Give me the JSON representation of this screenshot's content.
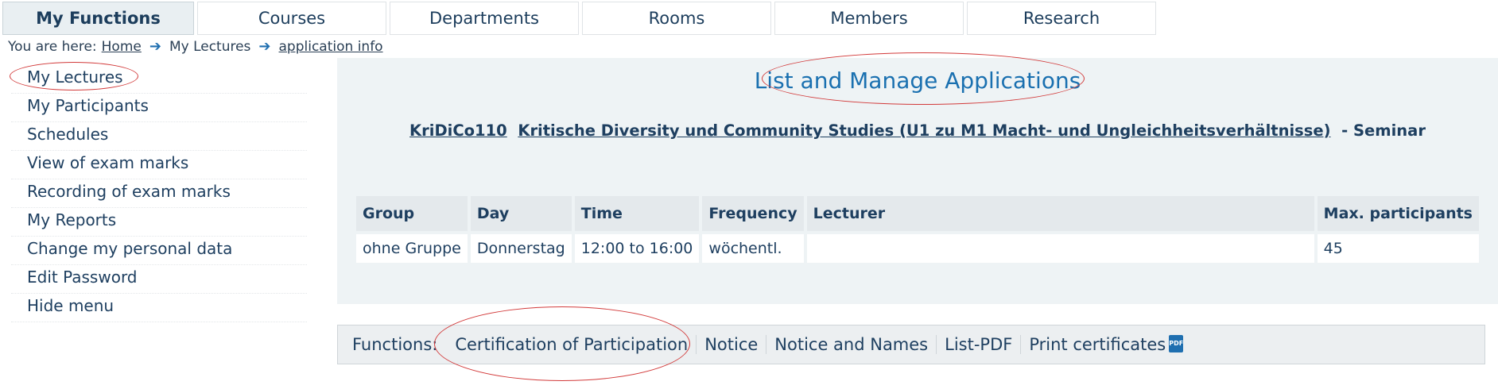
{
  "tabs": [
    {
      "label": "My Functions",
      "active": true
    },
    {
      "label": "Courses"
    },
    {
      "label": "Departments"
    },
    {
      "label": "Rooms"
    },
    {
      "label": "Members"
    },
    {
      "label": "Research"
    }
  ],
  "breadcrumb": {
    "prefix": "You are here:",
    "items": [
      "Home",
      "My Lectures",
      "application info"
    ]
  },
  "sidebar": {
    "items": [
      {
        "label": "My Lectures"
      },
      {
        "label": "My Participants"
      },
      {
        "label": "Schedules"
      },
      {
        "label": "View of exam marks"
      },
      {
        "label": "Recording of exam marks"
      },
      {
        "label": "My Reports"
      },
      {
        "label": "Change my personal data"
      },
      {
        "label": "Edit Password"
      },
      {
        "label": "Hide menu"
      }
    ]
  },
  "main": {
    "title": "List and Manage Applications",
    "course_code": "KriDiCo110",
    "course_title": "Kritische Diversity und Community Studies (U1 zu M1 Macht- und Ungleichheitsverhältnisse)",
    "course_type": "- Seminar",
    "table": {
      "headers": [
        "Group",
        "Day",
        "Time",
        "Frequency",
        "Lecturer",
        "Max. participants"
      ],
      "rows": [
        [
          "ohne Gruppe",
          "Donnerstag",
          "12:00 to 16:00",
          "wöchentl.",
          "",
          "45"
        ]
      ]
    }
  },
  "functions": {
    "label": "Functions:",
    "items": [
      "Certification of Participation",
      "Notice",
      "Notice and Names",
      "List-PDF",
      "Print certificates"
    ],
    "pdf_icon": "pdf-icon"
  },
  "colors": {
    "accent": "#1a70b0",
    "highlight_ring": "#d23a3a",
    "panel_bg": "#eef3f5"
  }
}
